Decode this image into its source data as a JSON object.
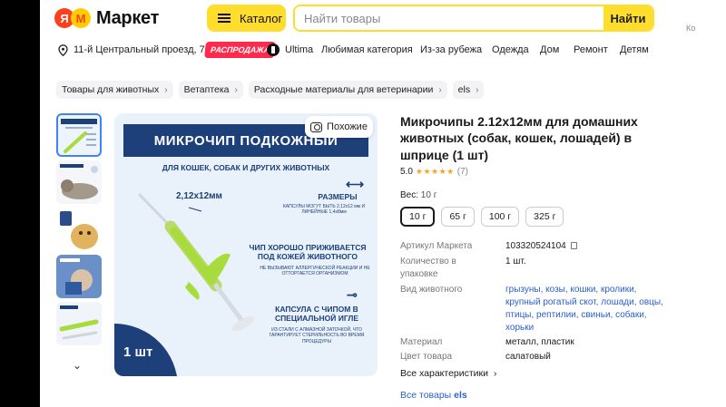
{
  "header": {
    "logo_text": "Маркет",
    "logo_ya": "Я",
    "logo_m": "М",
    "catalog_label": "Каталог",
    "search_placeholder": "Найти товары",
    "search_button": "Найти",
    "right_strip_text": "Ко"
  },
  "subnav": {
    "address": "11-й Центральный проезд, 70",
    "sale_badge": "РАСПРОДАЖА",
    "ultima": "Ultima",
    "links": [
      "Любимая категория",
      "Из-за рубежа",
      "Одежда",
      "Дом",
      "Ремонт",
      "Детям"
    ]
  },
  "breadcrumbs": [
    "Товары для животных",
    "Ветаптека",
    "Расходные материалы для ветеринарии",
    "els"
  ],
  "image": {
    "similar_label": "Похожие",
    "banner": "МИКРОЧИП ПОДКОЖНЫЙ",
    "subtitle": "ДЛЯ КОШЕК, СОБАК И ДРУГИХ ЖИВОТНЫХ",
    "size": "2,12х12мм",
    "size_head": "РАЗМЕРЫ",
    "size_note": "КАПСУЛЫ МОГУТ БЫТЬ 2,12х12 мм И ЛИНЕЙНЫЕ 1,4х8мм",
    "chip_head": "ЧИП ХОРОШО ПРИЖИВАЕТСЯ ПОД КОЖЕЙ ЖИВОТНОГО",
    "chip_note": "НЕ ВЫЗЫВАЮТ АЛЛЕРГИЧЕСКОЙ РЕАКЦИИ И НЕ ОТТОРГАЕТСЯ ОРГАНИЗМОМ",
    "capsule_head": "КАПСУЛА С ЧИПОМ В СПЕЦИАЛЬНОЙ ИГЛЕ",
    "capsule_note": "ИЗ СТАЛИ С АЛМАЗНОЙ ЗАТОЧКОЙ, ЧТО ГАРАНТИРУЕТ СТЕРИЛЬНОСТЬ ВО ВРЕМЯ ПРОЦЕДУРЫ",
    "count": "1 шт"
  },
  "product": {
    "title": "Микрочипы 2.12х12мм для домашних животных (собак, кошек, лошадей) в шприце (1 шт)",
    "rating_score": "5.0",
    "rating_stars": "★★★★★",
    "rating_count": "(7)",
    "weight_label": "Вес:",
    "weight_value": "10 г",
    "variants": [
      "10 г",
      "65 г",
      "100 г",
      "325 г"
    ],
    "specs": [
      {
        "key": "Артикул Маркета",
        "value": "103320524104"
      },
      {
        "key": "Количество в упаковке",
        "value": "1 шт."
      },
      {
        "key": "Вид животного",
        "value": "грызуны, козы, кошки, кролики, крупный рогатый скот, лошади, овцы, птицы, рептилии, свиньи, собаки, хорьки"
      },
      {
        "key": "Материал",
        "value": "металл, пластик"
      },
      {
        "key": "Цвет товара",
        "value": "салатовый"
      }
    ],
    "all_chars": "Все характеристики",
    "all_goods_prefix": "Все товары",
    "all_goods_brand": "els"
  },
  "colors": {
    "accent_yellow": "#ffdd2d",
    "sale_red": "#ff2a4d",
    "link_blue": "#2b5fcc",
    "banner_navy": "#1d3f7a",
    "syringe_green": "#a7dc3c"
  }
}
